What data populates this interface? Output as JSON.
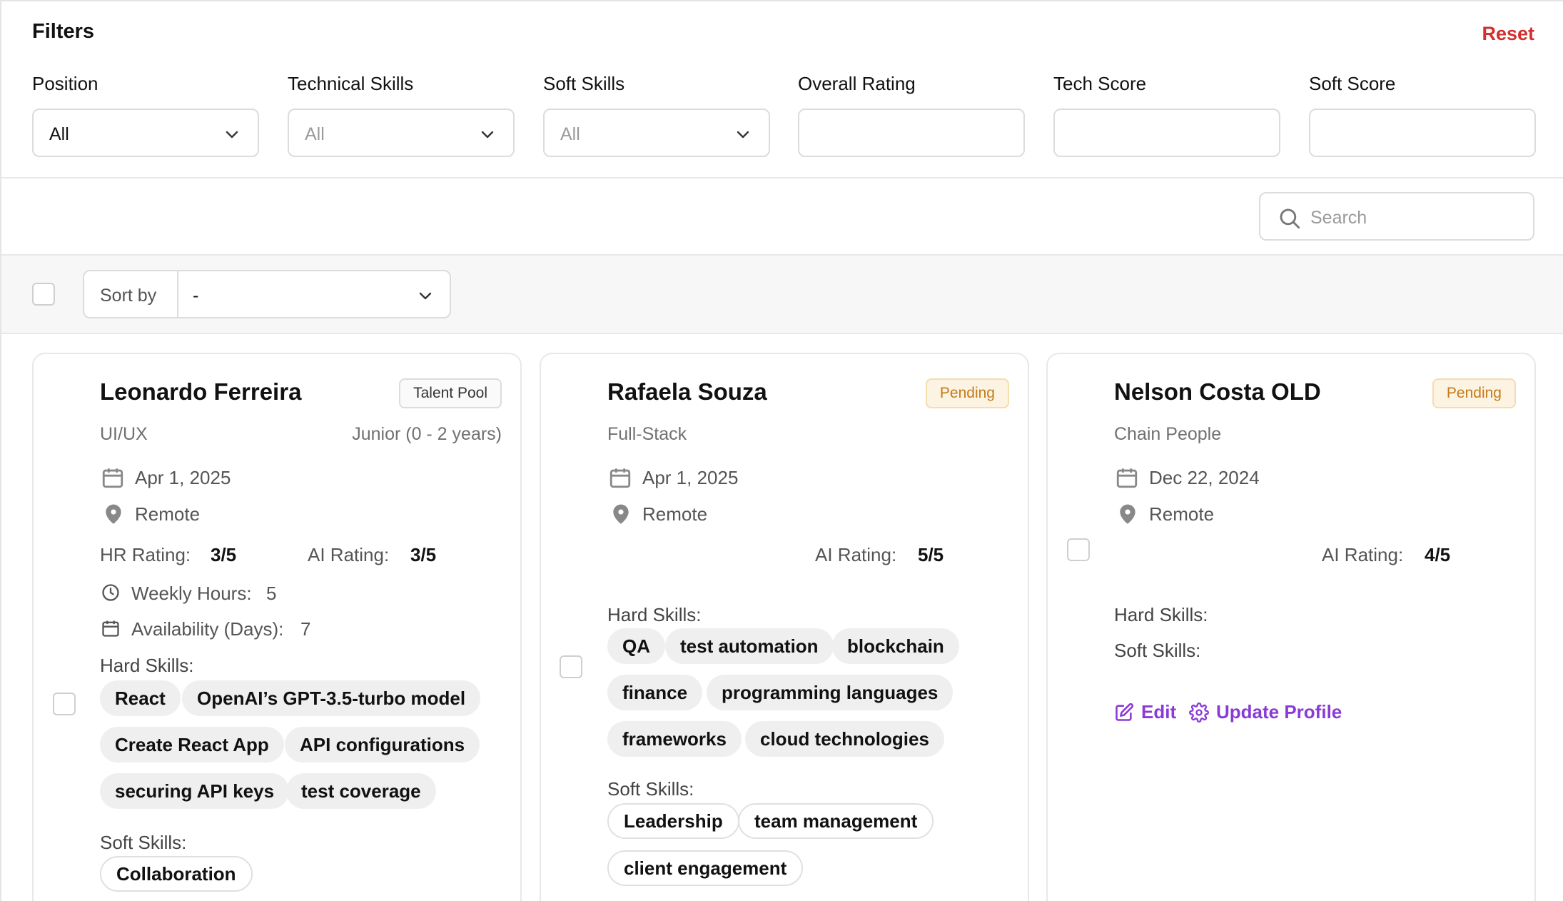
{
  "filters": {
    "title": "Filters",
    "reset_label": "Reset",
    "fields": [
      {
        "label": "Position",
        "value": "All"
      },
      {
        "label": "Technical Skills",
        "value": "All"
      },
      {
        "label": "Soft Skills",
        "value": "All"
      },
      {
        "label": "Overall Rating",
        "value": ""
      },
      {
        "label": "Tech Score",
        "value": ""
      },
      {
        "label": "Soft Score",
        "value": ""
      }
    ]
  },
  "search": {
    "placeholder": "Search"
  },
  "toolbar": {
    "sort_label": "Sort by",
    "sort_value": "-"
  },
  "cards": [
    {
      "name": "Leonardo Ferreira",
      "status": "Talent Pool",
      "role": "UI/UX",
      "seniority": "Junior (0 - 2 years)",
      "date": "Apr 1, 2025",
      "location": "Remote",
      "hr_rating_label": "HR Rating:",
      "hr_rating": "3/5",
      "ai_rating_label": "AI Rating:",
      "ai_rating": "3/5",
      "weekly_hours_label": "Weekly Hours:",
      "weekly_hours": "5",
      "availability_label": "Availability (Days):",
      "availability": "7",
      "hard_skills_label": "Hard Skills:",
      "hard_skills": [
        "React",
        "OpenAI’s GPT-3.5-turbo model",
        "Create React App",
        "API configurations",
        "securing API keys",
        "test coverage"
      ],
      "soft_skills_label": "Soft Skills:",
      "soft_skills": [
        "Collaboration"
      ]
    },
    {
      "name": "Rafaela Souza",
      "status": "Pending",
      "role": "Full-Stack",
      "date": "Apr 1, 2025",
      "location": "Remote",
      "ai_rating_label": "AI Rating:",
      "ai_rating": "5/5",
      "hard_skills_label": "Hard Skills:",
      "hard_skills": [
        "QA",
        "test automation",
        "blockchain",
        "finance",
        "programming languages",
        "frameworks",
        "cloud technologies"
      ],
      "soft_skills_label": "Soft Skills:",
      "soft_skills": [
        "Leadership",
        "team management",
        "client engagement"
      ]
    },
    {
      "name": "Nelson Costa OLD",
      "status": "Pending",
      "role": "Chain People",
      "date": "Dec 22, 2024",
      "location": "Remote",
      "ai_rating_label": "AI Rating:",
      "ai_rating": "4/5",
      "hard_skills_label": "Hard Skills:",
      "soft_skills_label": "Soft Skills:",
      "edit_label": "Edit",
      "update_label": "Update Profile"
    }
  ],
  "colors": {
    "accent": "#8a3ad6",
    "reset": "#d32f2f",
    "pending": "#c47a17"
  }
}
